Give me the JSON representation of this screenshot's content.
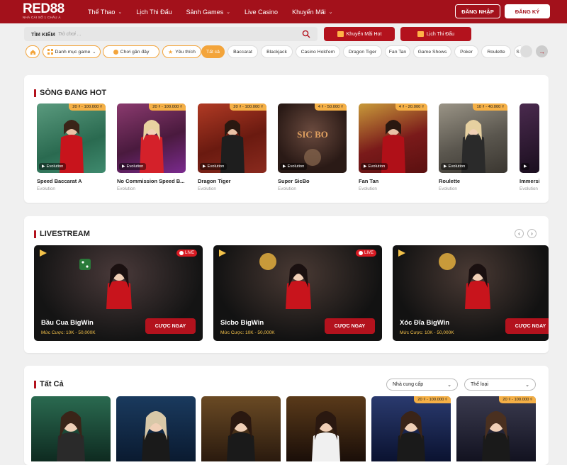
{
  "header": {
    "logo_main": "RED88",
    "logo_sub": "NHÀ CÁI SỐ 1 CHÂU Á",
    "nav": [
      {
        "label": "Thể Thao",
        "dropdown": true
      },
      {
        "label": "Lịch Thi Đấu",
        "dropdown": false
      },
      {
        "label": "Sảnh Games",
        "dropdown": true
      },
      {
        "label": "Live Casino",
        "dropdown": false
      },
      {
        "label": "Khuyến Mãi",
        "dropdown": true
      }
    ],
    "login_label": "ĐĂNG NHẬP",
    "register_label": "ĐĂNG KÝ",
    "chevron": "⌄"
  },
  "search": {
    "label": "TÌM KIẾM",
    "placeholder": "Trò chơi ..."
  },
  "promo_buttons": {
    "promo_label": "Khuyến Mãi Hot",
    "schedule_label": "Lịch Thi Đấu"
  },
  "filters": {
    "category_label": "Danh mục game",
    "recent_label": "Chơi gần đây",
    "favorite_label": "Yêu thích",
    "chips": [
      "Tất cả",
      "Baccarat",
      "Blackjack",
      "Casino Hold'em",
      "Dragon Tiger",
      "Fan Tan",
      "Game Shows",
      "Poker",
      "Roulette",
      "S"
    ]
  },
  "hot": {
    "title": "SÒNG ĐANG HOT",
    "games": [
      {
        "name": "Speed Baccarat A",
        "provider": "Evolution",
        "bet_range": "20 ₫ - 100.000 ₫",
        "bg": "#3f8a6e"
      },
      {
        "name": "No Commission Speed B...",
        "provider": "Evolution",
        "bet_range": "20 ₫ - 100.000 ₫",
        "bg": "#6a2e5e"
      },
      {
        "name": "Dragon Tiger",
        "provider": "Evolution",
        "bet_range": "20 ₫ - 100.000 ₫",
        "bg": "#8a2a1e"
      },
      {
        "name": "Super SicBo",
        "provider": "Evolution",
        "bet_range": "4 ₫ - 50.000 ₫",
        "bg": "#3a2a26"
      },
      {
        "name": "Fan Tan",
        "provider": "Evolution",
        "bet_range": "4 ₫ - 20.000 ₫",
        "bg": "#5a1a1a"
      },
      {
        "name": "Roulette",
        "provider": "Evolution",
        "bet_range": "10 ₫ - 40.000 ₫",
        "bg": "#6e6a60"
      },
      {
        "name": "Immersi",
        "provider": "Evolution",
        "bet_range": "",
        "bg": "#2a1a2e"
      }
    ]
  },
  "livestream": {
    "title": "LIVESTREAM",
    "live_label": "LIVE",
    "play_label": "CƯỢC NGAY",
    "streams": [
      {
        "name": "Bầu Cua BigWin",
        "bet": "Mức Cược: 10K - 50,000K",
        "live": true
      },
      {
        "name": "Sicbo BigWin",
        "bet": "Mức Cược: 10K - 50,000K",
        "live": true
      },
      {
        "name": "Xóc Đĩa BigWin",
        "bet": "Mức Cược: 10K - 50,000K",
        "live": false
      }
    ]
  },
  "all": {
    "title": "Tất Cả",
    "provider_filter": "Nhà cung cấp",
    "type_filter": "Thể loại",
    "cards": [
      {
        "badge": "",
        "bg": "#1e4a3a"
      },
      {
        "badge": "",
        "bg": "#0e2a48"
      },
      {
        "badge": "",
        "bg": "#3a2a14"
      },
      {
        "badge": "",
        "bg": "#2a1a10"
      },
      {
        "badge": "20 ₫ - 100.000 ₫",
        "bg": "#0e1a3a"
      },
      {
        "badge": "20 ₫ - 100.000 ₫",
        "bg": "#1a1a2e"
      }
    ]
  },
  "colors": {
    "brand_red": "#a3111b",
    "accent_orange": "#f3a43a"
  }
}
